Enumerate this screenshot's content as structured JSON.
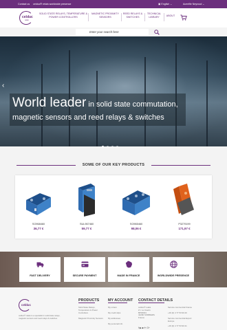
{
  "topbar": {
    "contact": "Contact us",
    "shop": "celduc® relais worldwide presence",
    "lang": "English",
    "account": "Acenfile Neyroud"
  },
  "nav": {
    "logo_text": "celduc",
    "logo_sub": "relais",
    "items": [
      {
        "line1": "SOLID STATE RELAYS, TEMPERATURE &",
        "line2": "POWER CONTROLLERS"
      },
      {
        "line1": "MAGNETIC PROXIMITY",
        "line2": "SENSORS"
      },
      {
        "line1": "REED RELAYS &",
        "line2": "SWITCHES"
      },
      {
        "line1": "TECHNICAL",
        "line2": "LIBRARY"
      },
      {
        "line1": "ABOUT",
        "line2": ""
      }
    ]
  },
  "search": {
    "placeholder": "Enter your search here"
  },
  "hero": {
    "title_big": "World leader",
    "title_small": " in solid state commutation,",
    "subtitle": "magnetic sensors and reed relays & switches",
    "arrow": "‹"
  },
  "products_section": {
    "title": "SOME OF OUR KEY PRODUCTS",
    "items": [
      {
        "ref": "SO968460",
        "price": "36,77 €"
      },
      {
        "ref": "SUL967460",
        "price": "59,77 €"
      },
      {
        "ref": "SO965460",
        "price": "98,06 €"
      },
      {
        "ref": "P3279199",
        "price": "171,97 €"
      }
    ]
  },
  "features": [
    {
      "label": "FAST DELIVERY",
      "icon": "truck-icon"
    },
    {
      "label": "SECURE PAYMENT",
      "icon": "credit-card-icon"
    },
    {
      "label": "MADE IN FRANCE",
      "icon": "france-map-icon"
    },
    {
      "label": "WORLDWIDE PRESENCE",
      "icon": "globe-icon"
    }
  ],
  "footer": {
    "logo_text": "celduc",
    "description": "celduc® relais is a specialist in solid state relays, magnetic sensors and reed relays & switches",
    "products": {
      "heading": "PRODUCTS",
      "items": [
        "Solid State Relays, Temperature & Power Controllers",
        "Magnetic Proximity Sensors"
      ]
    },
    "account": {
      "heading": "MY ACCOUNT",
      "items": [
        "My orders",
        "My credit slips",
        "My addresses",
        "My personal info"
      ]
    },
    "contact": {
      "heading": "CONTACT DETAILS",
      "address": "celduc® relais\nZ.I. Le Inserts\nBP30004\n42290 SORBIERS\nFrance",
      "service1": "Service commercial France",
      "phone1": "+33 (0) 4 77 53 90 20",
      "service2": "Service commercial Export Europe",
      "phone2": "+33 (0) 4 77 53 90 21",
      "social": "f ▶ ◙ ✈ G+"
    }
  },
  "colors": {
    "brand": "#6b2e7d",
    "price": "#6b2e7d"
  }
}
